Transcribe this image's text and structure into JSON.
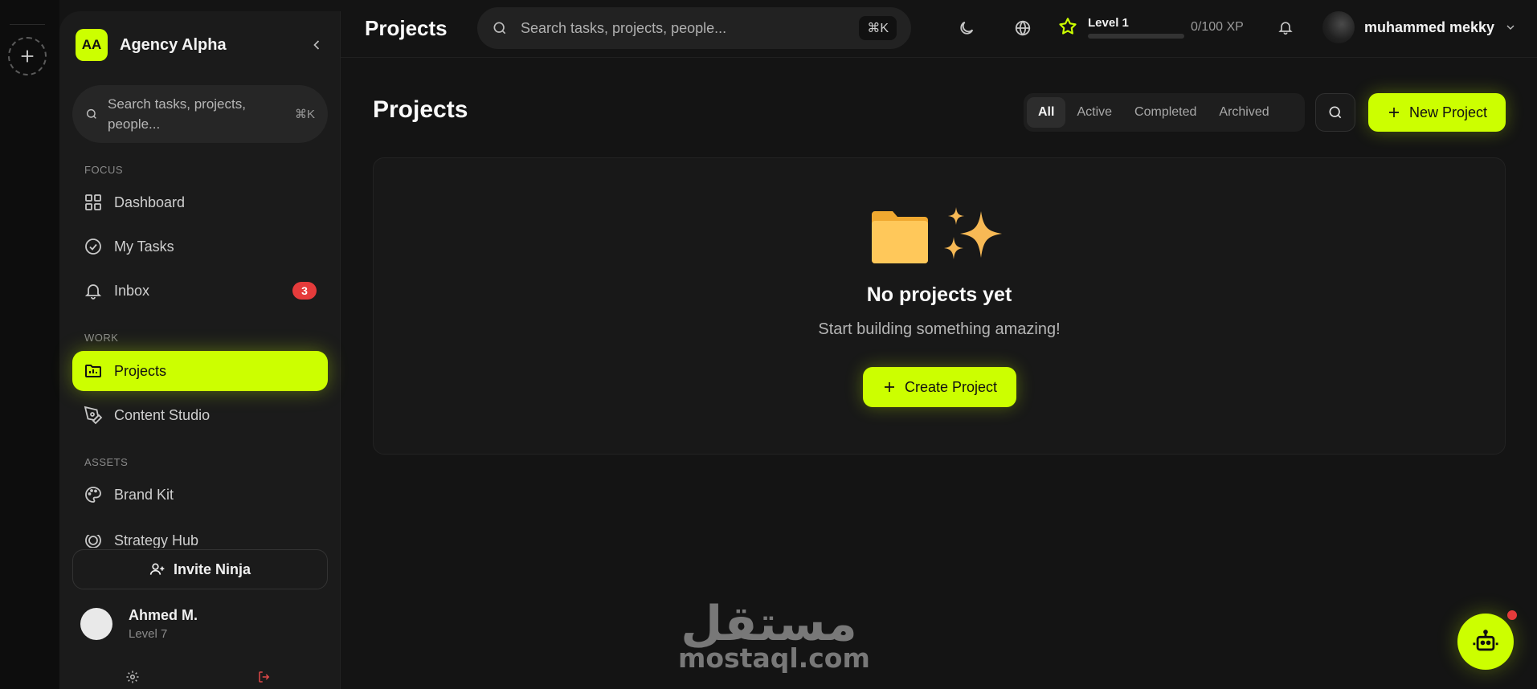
{
  "workspace": {
    "initials": "AA",
    "name": "Agency Alpha"
  },
  "sidebar": {
    "search_placeholder": "Search tasks, projects, people...",
    "search_shortcut": "⌘K",
    "sections": {
      "focus": "FOCUS",
      "work": "WORK",
      "assets": "ASSETS"
    },
    "items": [
      {
        "label": "Dashboard",
        "icon": "dashboard-icon"
      },
      {
        "label": "My Tasks",
        "icon": "check-circle-icon"
      },
      {
        "label": "Inbox",
        "icon": "bell-icon",
        "badge": "3"
      },
      {
        "label": "Projects",
        "icon": "projects-folder-icon",
        "active": true
      },
      {
        "label": "Content Studio",
        "icon": "pen-tool-icon"
      },
      {
        "label": "Brand Kit",
        "icon": "palette-icon"
      },
      {
        "label": "Strategy Hub",
        "icon": "target-icon"
      }
    ],
    "invite_label": "Invite Ninja",
    "user": {
      "name": "Ahmed M.",
      "level": "Level 7"
    }
  },
  "header": {
    "title": "Projects",
    "search_placeholder": "Search tasks, projects, people...",
    "search_shortcut": "⌘K",
    "level_label": "Level 1",
    "level_progress": 0,
    "xp": "0/100 XP",
    "profile_name": "muhammed mekky"
  },
  "main": {
    "title": "Projects",
    "filters": [
      "All",
      "Active",
      "Completed",
      "Archived"
    ],
    "active_filter": "All",
    "new_button": "New Project",
    "empty": {
      "title": "No projects yet",
      "subtitle": "Start building something amazing!",
      "button": "Create Project"
    }
  },
  "watermark": {
    "arabic": "مستقل",
    "latin": "mostaql.com"
  },
  "colors": {
    "accent": "#ccff00",
    "badge": "#e53b3b",
    "background": "#141414",
    "sidebar": "#1b1b1b"
  }
}
